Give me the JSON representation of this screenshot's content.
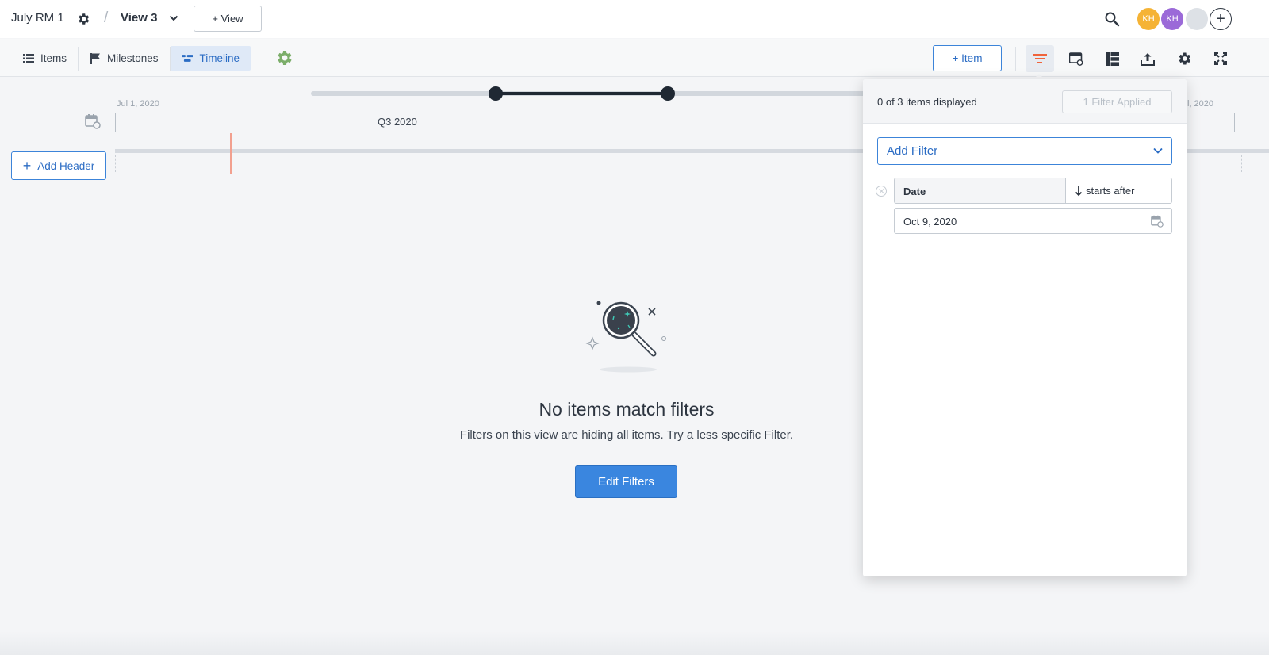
{
  "topbar": {
    "roadmap_name": "July RM 1",
    "separator": "/",
    "view_name": "View 3",
    "add_view_label": "+ View",
    "avatars": [
      "KH",
      "KH",
      "",
      "+"
    ],
    "avatar_colors": [
      "#f5b335",
      "#9b6ad8",
      "#dde1e6"
    ]
  },
  "nav": {
    "tabs": [
      {
        "label": "Items",
        "icon": "list-icon"
      },
      {
        "label": "Milestones",
        "icon": "flag-icon"
      },
      {
        "label": "Timeline",
        "icon": "timeline-icon",
        "active": true
      }
    ],
    "add_item_label": "+ Item",
    "tools": [
      "filter-icon",
      "card-settings-icon",
      "layout-icon",
      "export-icon",
      "gear-icon",
      "fullscreen-icon"
    ]
  },
  "timeline": {
    "start_date": "Jul 1, 2020",
    "end_date": "l, 2020",
    "quarter": "Q3 2020",
    "add_header_label": "Add Header"
  },
  "empty_state": {
    "title": "No items match filters",
    "subtitle": "Filters on this view are hiding all items. Try a less specific Filter.",
    "button_label": "Edit Filters"
  },
  "filter_panel": {
    "items_displayed": "0 of 3 items displayed",
    "filters_applied": "1 Filter Applied",
    "add_filter_label": "Add Filter",
    "filter": {
      "field": "Date",
      "condition": "starts after",
      "value": "Oct 9, 2020"
    }
  },
  "colors": {
    "accent": "#3a86df",
    "active_filter_icon": "#f0643c",
    "gear_green": "#7cae6a"
  }
}
